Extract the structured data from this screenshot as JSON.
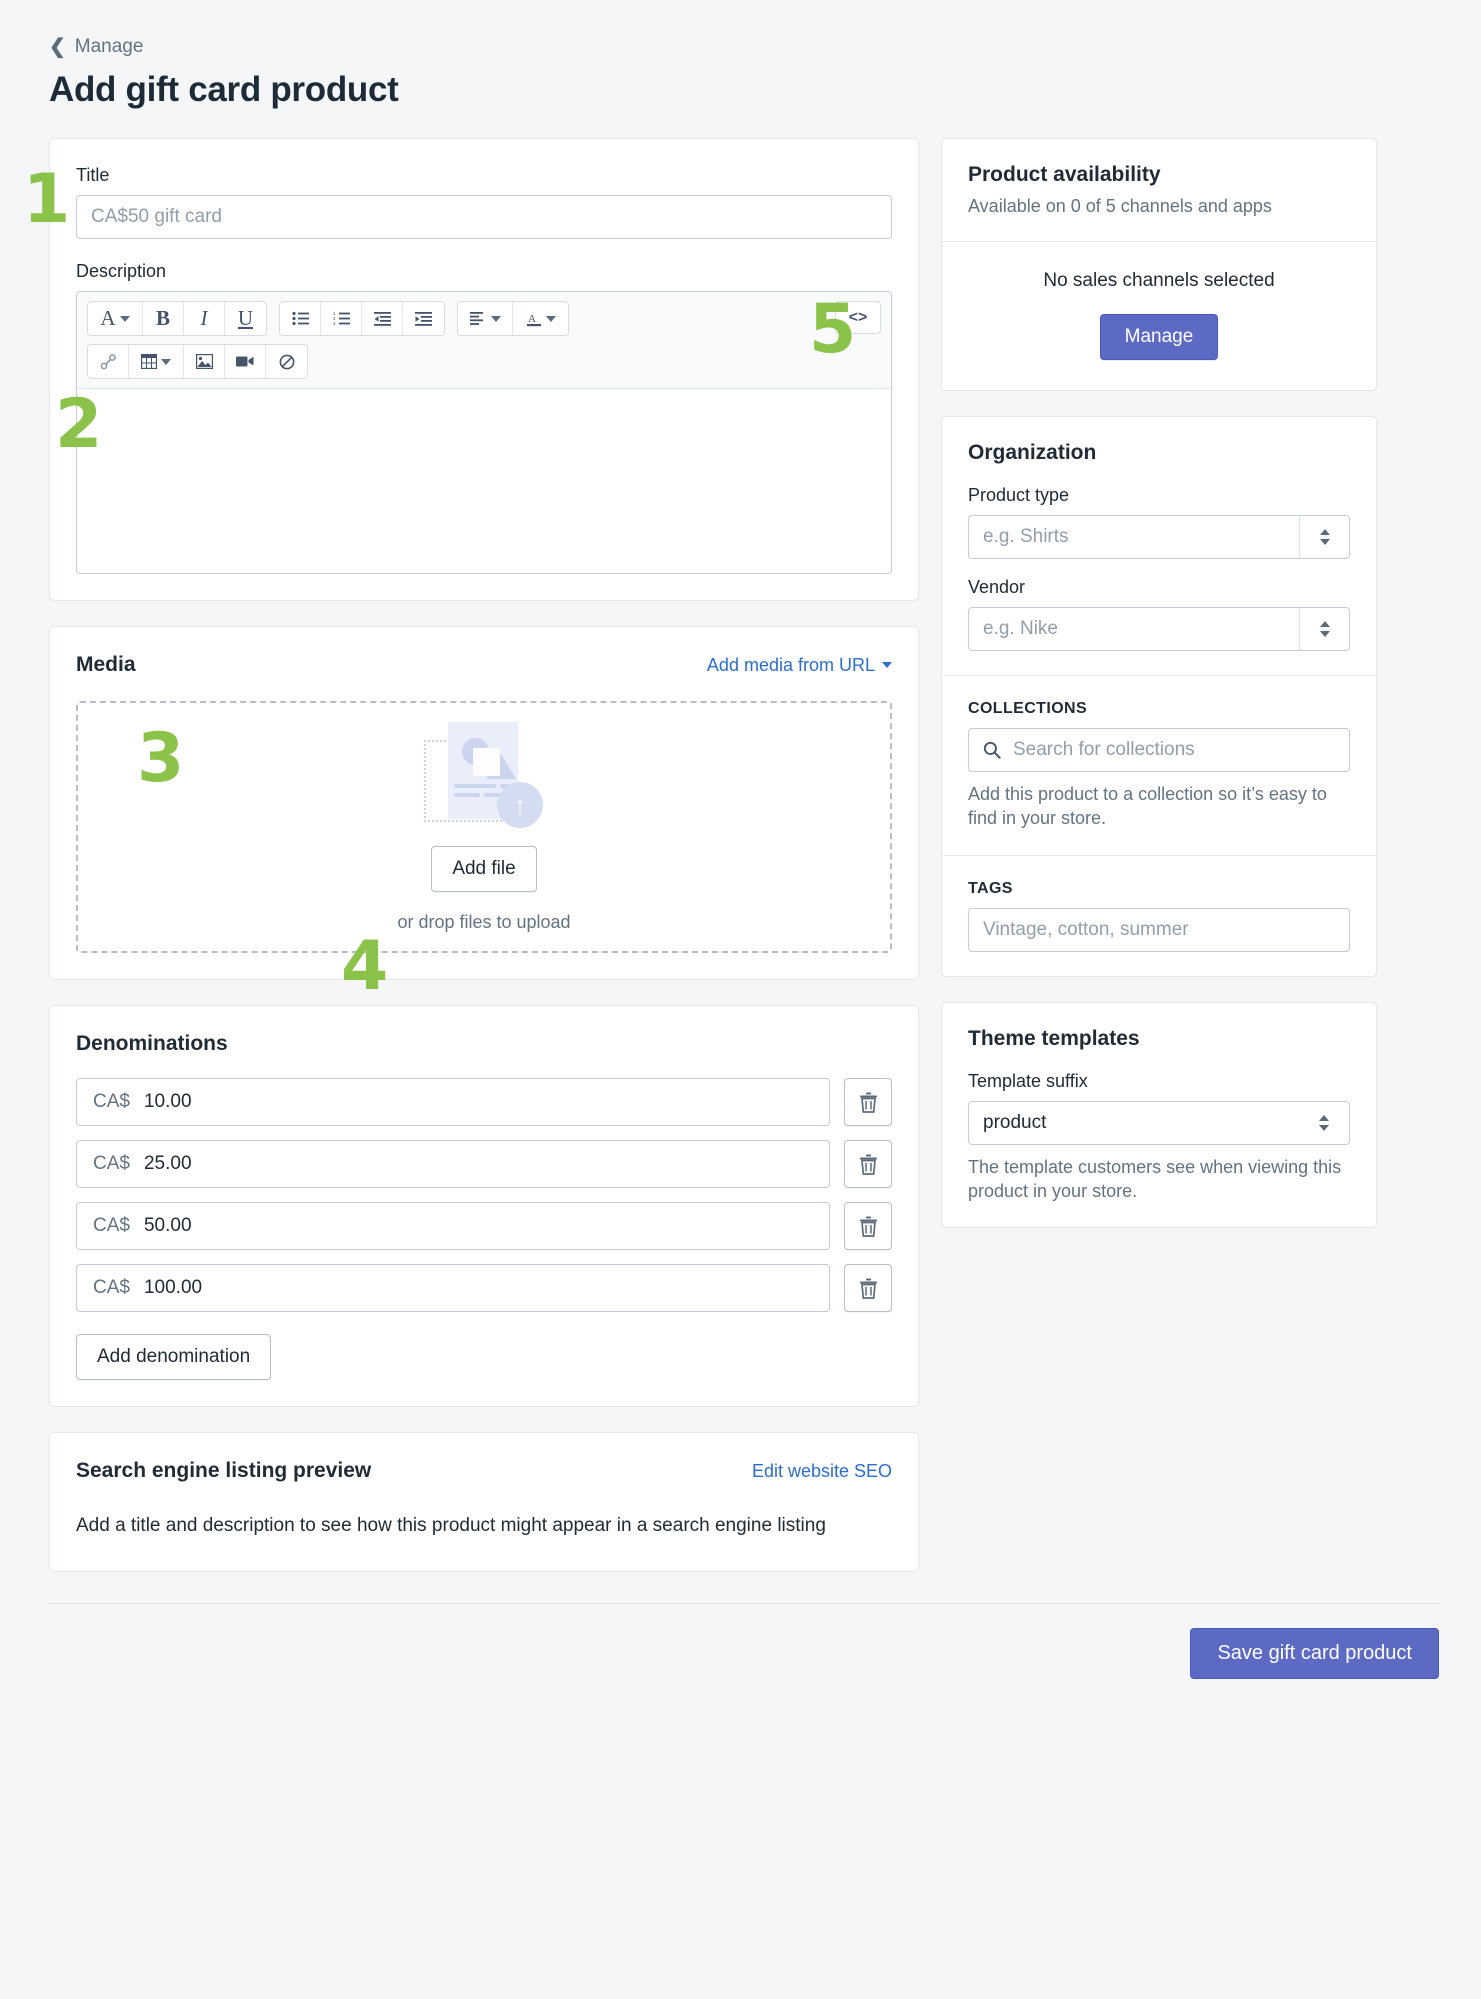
{
  "header": {
    "back_label": "Manage",
    "back_icon": "chevron-left-icon",
    "title": "Add gift card product"
  },
  "product_form": {
    "title_label": "Title",
    "title_placeholder": "CA$50 gift card",
    "title_value": "",
    "description_label": "Description",
    "editor": {
      "row1": [
        {
          "icon": "font-family-icon",
          "glyph": "A",
          "caret": true
        },
        {
          "icon": "bold-icon",
          "glyph": "B",
          "caret": false
        },
        {
          "icon": "italic-icon",
          "glyph": "I",
          "caret": false
        },
        {
          "icon": "underline-icon",
          "glyph": "U",
          "caret": false
        },
        {
          "icon": "bulleted-list-icon",
          "glyph": "",
          "caret": false
        },
        {
          "icon": "numbered-list-icon",
          "glyph": "",
          "caret": false
        },
        {
          "icon": "outdent-icon",
          "glyph": "",
          "caret": false
        },
        {
          "icon": "indent-icon",
          "glyph": "",
          "caret": false
        },
        {
          "icon": "align-icon",
          "glyph": "",
          "caret": true
        },
        {
          "icon": "text-color-icon",
          "glyph": "A",
          "caret": true
        }
      ],
      "row2": [
        {
          "icon": "link-icon"
        },
        {
          "icon": "table-icon",
          "caret": true
        },
        {
          "icon": "image-icon"
        },
        {
          "icon": "video-icon"
        },
        {
          "icon": "clear-formatting-icon"
        }
      ],
      "code_button": "<>",
      "code_icon": "code-view-icon",
      "body_value": ""
    }
  },
  "media": {
    "title": "Media",
    "add_from_url_label": "Add media from URL",
    "add_from_url_icon": "chevron-down-icon",
    "upload_illustration_icon": "upload-image-icon",
    "add_file_label": "Add file",
    "drop_hint": "or drop files to upload"
  },
  "denominations": {
    "title": "Denominations",
    "rows": [
      {
        "currency": "CA$",
        "amount": "10.00",
        "delete_icon": "trash-icon"
      },
      {
        "currency": "CA$",
        "amount": "25.00",
        "delete_icon": "trash-icon"
      },
      {
        "currency": "CA$",
        "amount": "50.00",
        "delete_icon": "trash-icon"
      },
      {
        "currency": "CA$",
        "amount": "100.00",
        "delete_icon": "trash-icon"
      }
    ],
    "add_label": "Add denomination"
  },
  "seo": {
    "title": "Search engine listing preview",
    "edit_link": "Edit website SEO",
    "empty_text": "Add a title and description to see how this product might appear in a search engine listing"
  },
  "sidebar": {
    "availability": {
      "title": "Product availability",
      "subtitle": "Available on 0 of 5 channels and apps",
      "empty_text": "No sales channels selected",
      "manage_label": "Manage"
    },
    "organization": {
      "title": "Organization",
      "product_type_label": "Product type",
      "product_type_placeholder": "e.g. Shirts",
      "product_type_value": "",
      "vendor_label": "Vendor",
      "vendor_placeholder": "e.g. Nike",
      "vendor_value": "",
      "collections_label": "COLLECTIONS",
      "collections_placeholder": "Search for collections",
      "collections_search_icon": "search-icon",
      "collections_help": "Add this product to a collection so it’s easy to find in your store.",
      "tags_label": "TAGS",
      "tags_placeholder": "Vintage, cotton, summer",
      "tags_value": ""
    },
    "theme": {
      "title": "Theme templates",
      "suffix_label": "Template suffix",
      "suffix_value": "product",
      "help": "The template customers see when viewing this product in your store."
    }
  },
  "footer": {
    "save_label": "Save gift card product"
  },
  "annotations": [
    {
      "number": "1"
    },
    {
      "number": "2"
    },
    {
      "number": "3"
    },
    {
      "number": "4"
    },
    {
      "number": "5"
    }
  ],
  "colors": {
    "accent": "#5c6ac4",
    "link": "#2c6ecb",
    "page_bg": "#f4f6f8",
    "badge": "#8bc34a"
  }
}
